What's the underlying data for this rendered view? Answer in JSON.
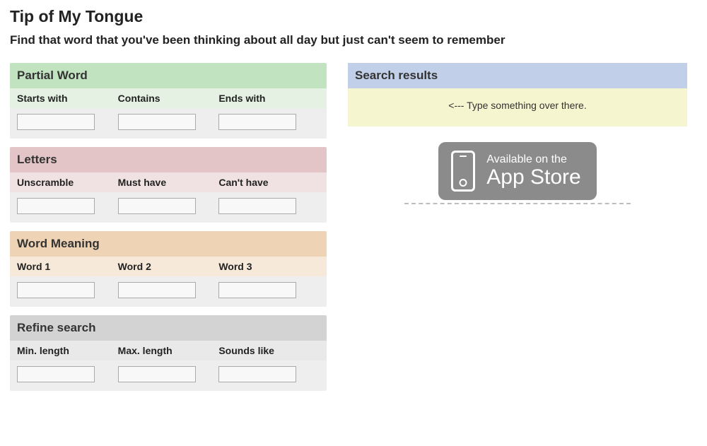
{
  "page": {
    "title": "Tip of My Tongue",
    "subtitle": "Find that word that you've been thinking about all day but just can't seem to remember"
  },
  "panels": {
    "partial": {
      "title": "Partial Word",
      "labels": [
        "Starts with",
        "Contains",
        "Ends with"
      ],
      "values": [
        "",
        "",
        ""
      ]
    },
    "letters": {
      "title": "Letters",
      "labels": [
        "Unscramble",
        "Must have",
        "Can't have"
      ],
      "values": [
        "",
        "",
        ""
      ]
    },
    "meaning": {
      "title": "Word Meaning",
      "labels": [
        "Word 1",
        "Word 2",
        "Word 3"
      ],
      "values": [
        "",
        "",
        ""
      ]
    },
    "refine": {
      "title": "Refine search",
      "labels": [
        "Min. length",
        "Max. length",
        "Sounds like"
      ],
      "values": [
        "",
        "",
        ""
      ]
    }
  },
  "results": {
    "title": "Search results",
    "placeholder_message": "<--- Type something over there."
  },
  "appstore": {
    "line1": "Available on the",
    "line2": "App Store"
  }
}
